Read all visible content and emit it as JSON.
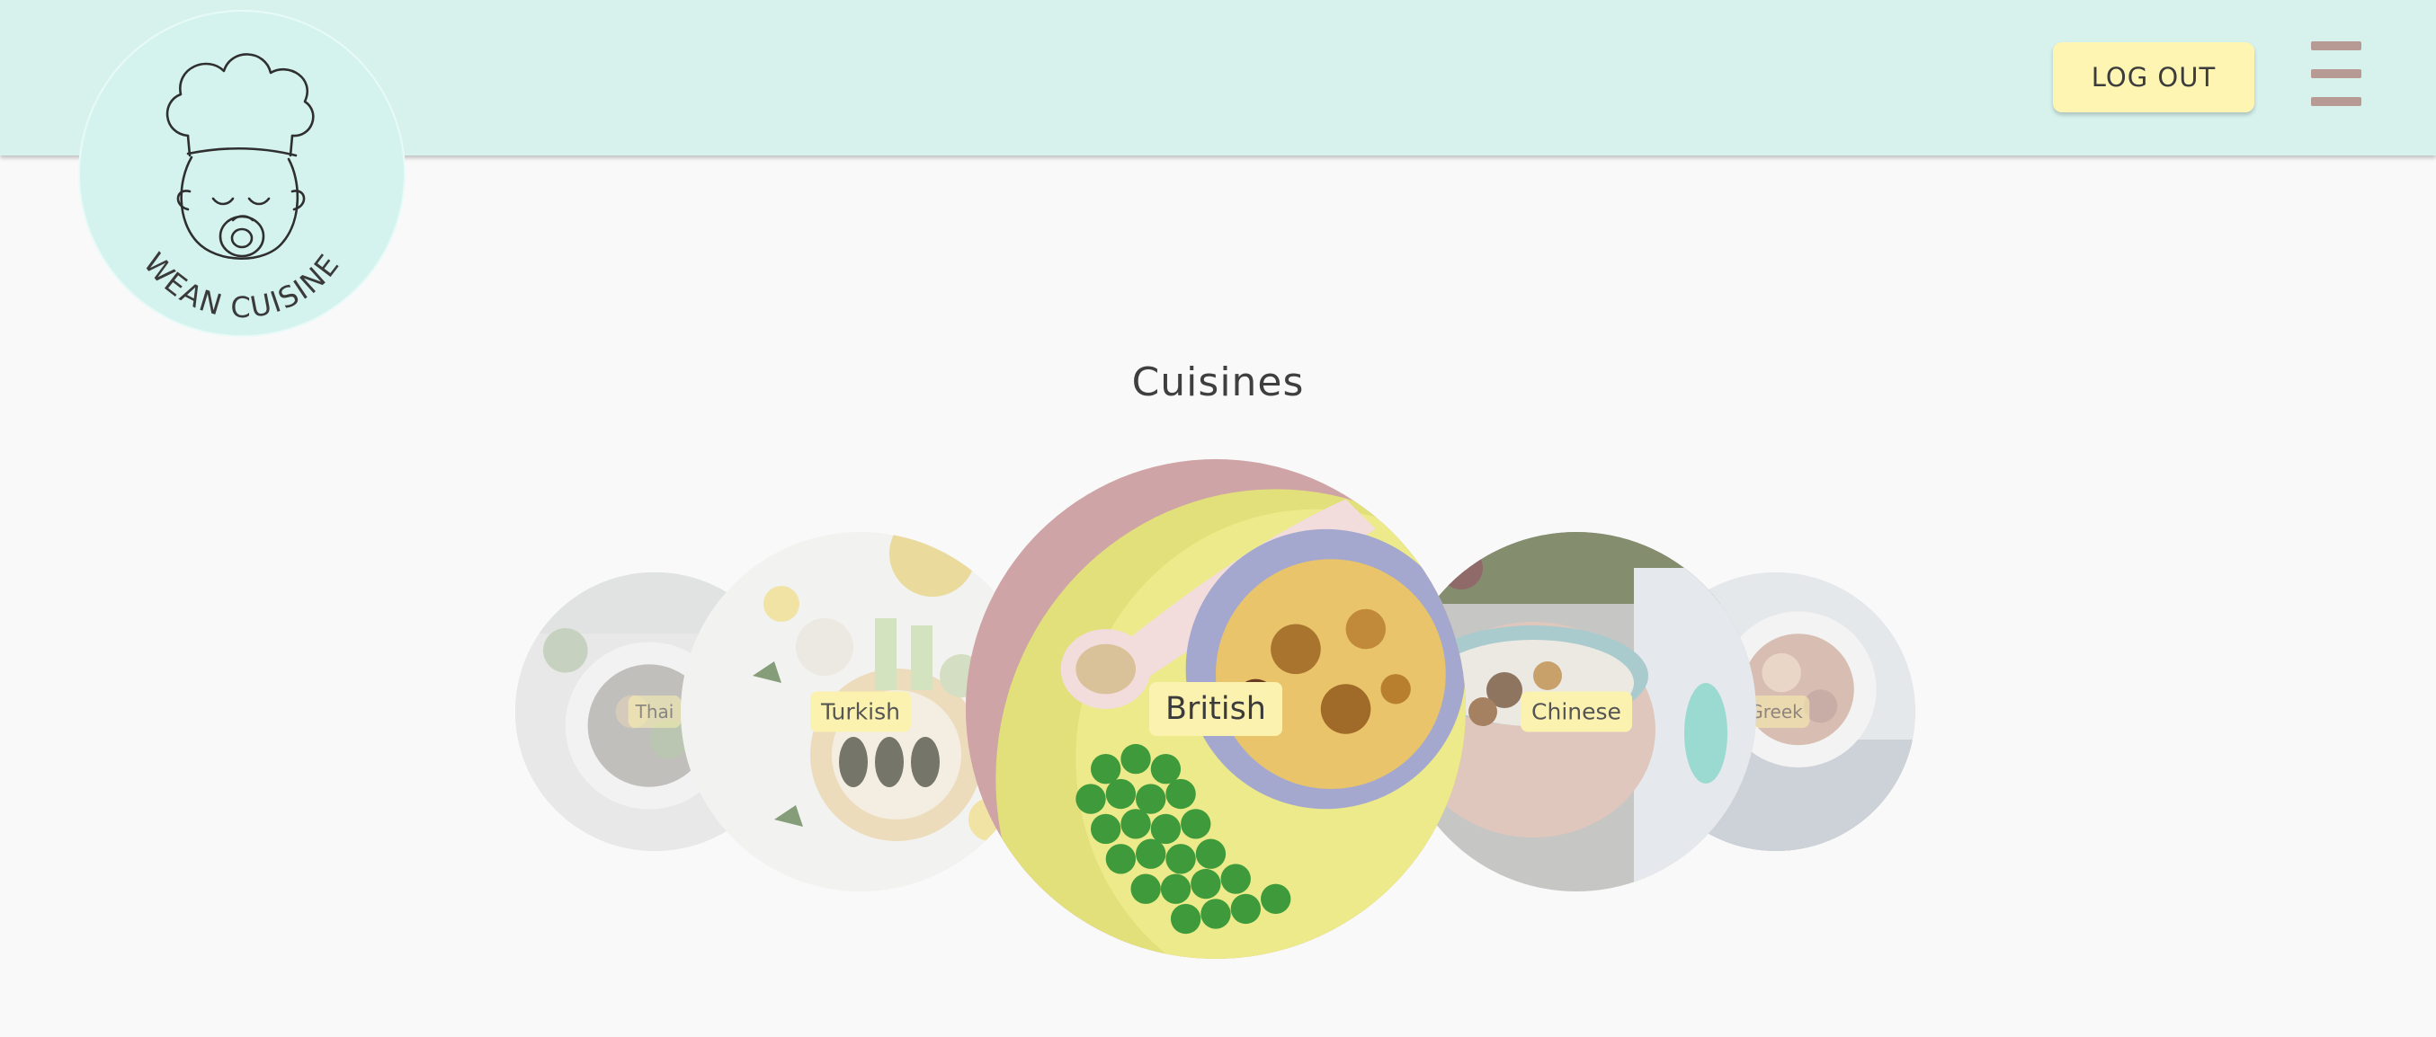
{
  "header": {
    "logo_text": "WEAN CUISINE",
    "logout_label": "LOG OUT",
    "menu_icon": "hamburger-menu-icon"
  },
  "main": {
    "title": "Cuisines",
    "cuisines": [
      {
        "label": "Thai"
      },
      {
        "label": "Turkish"
      },
      {
        "label": "British"
      },
      {
        "label": "Chinese"
      },
      {
        "label": "Greek"
      }
    ]
  },
  "colors": {
    "header_bg": "#d7f2ed",
    "button_bg": "#fff5b3",
    "menu_icon": "#b89a94",
    "page_bg": "#f9f9f9"
  }
}
